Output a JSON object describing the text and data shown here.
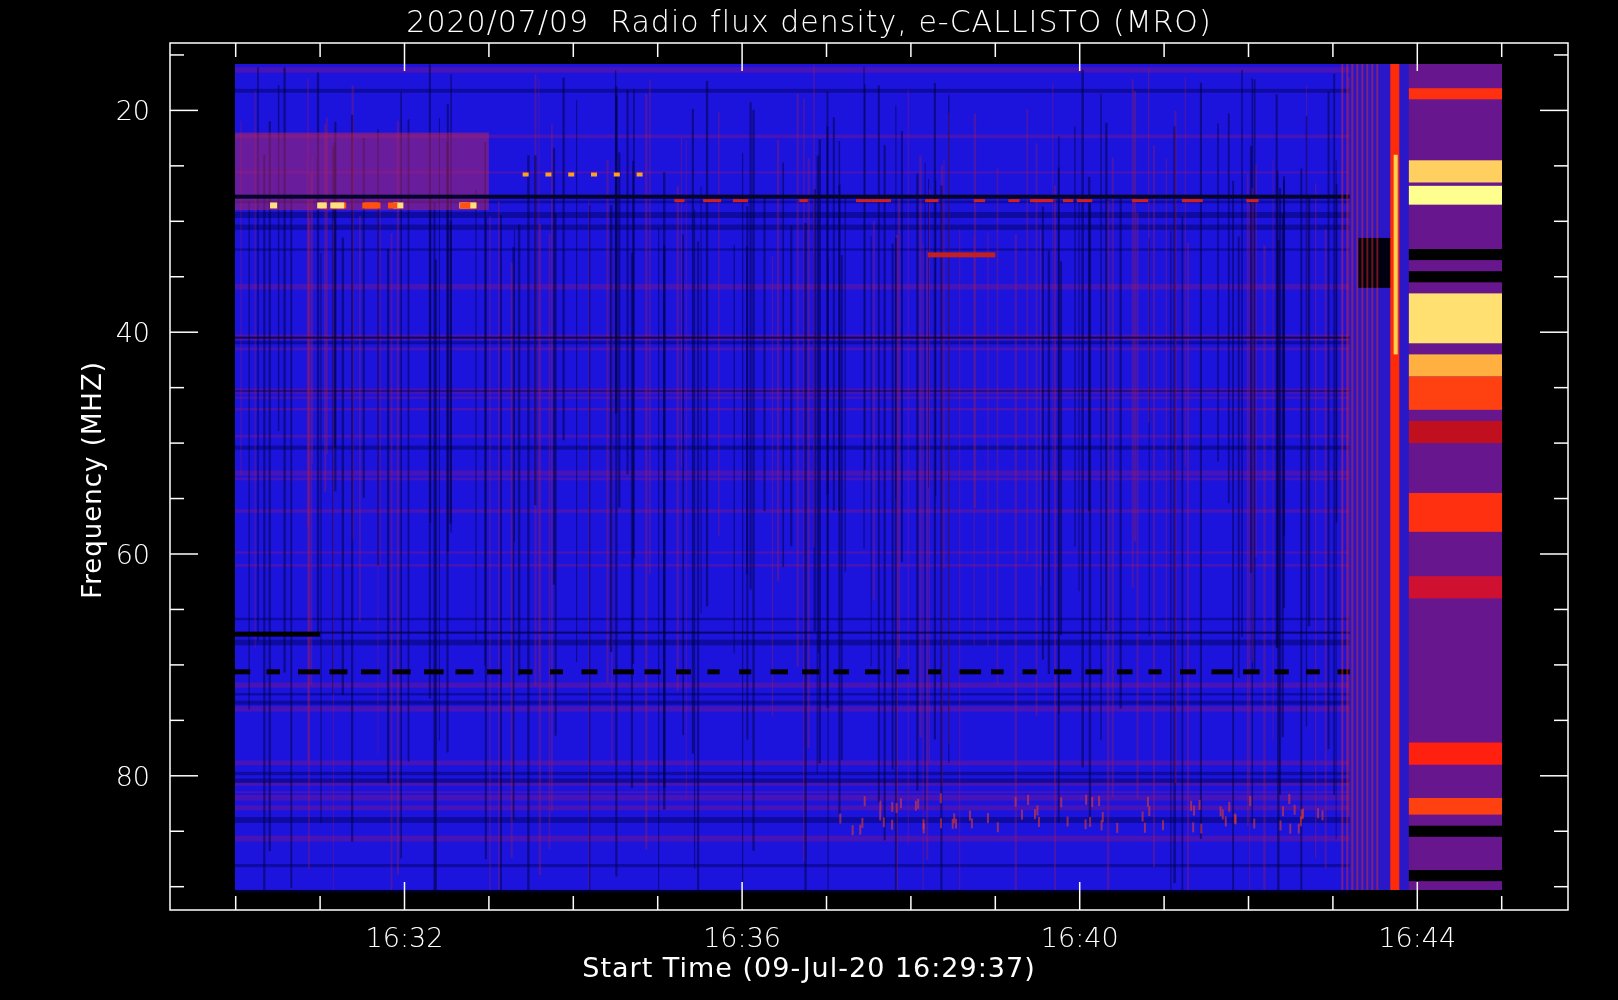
{
  "title": "2020/07/09  Radio flux density, e-CALLISTO (MRO)",
  "y_axis": {
    "label": "Frequency (MHZ)",
    "ticks": [
      "20",
      "40",
      "60",
      "80"
    ]
  },
  "x_axis": {
    "label": "Start Time (09-Jul-20 16:29:37)",
    "ticks": [
      "16:32",
      "16:36",
      "16:40",
      "16:44"
    ]
  }
}
